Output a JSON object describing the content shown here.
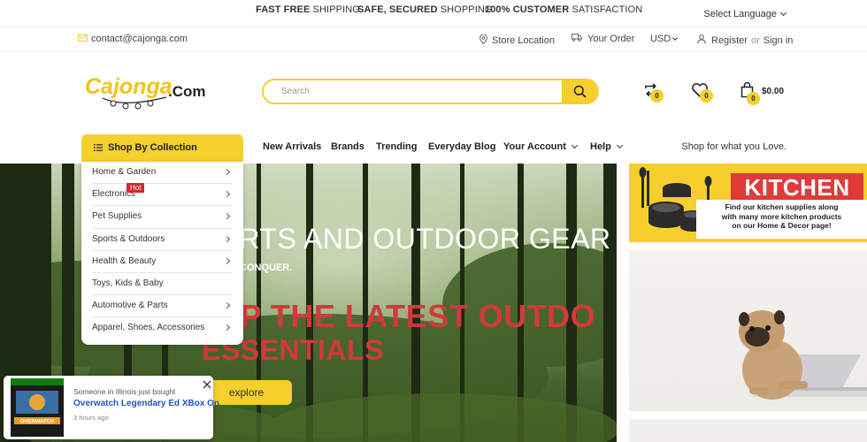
{
  "promo": {
    "item1_bold": "FAST FREE",
    "item1_rest": " SHIPPING",
    "item2_bold": "SAFE, SECURED",
    "item2_rest": " SHOPPING",
    "item3_bold": "100% CUSTOMER",
    "item3_rest": " SATISFACTION",
    "language": "Select Language"
  },
  "contactbar": {
    "email": "contact@cajonga.com",
    "store_location": "Store Location",
    "your_order": "Your Order",
    "currency": "USD",
    "register": "Register",
    "or": "or",
    "sign_in": "Sign in"
  },
  "header": {
    "logo_text": "CaJonga.Com",
    "search_placeholder": "Search",
    "compare_count": "0",
    "wishlist_count": "0",
    "cart_count": "0",
    "cart_total": "$0.00"
  },
  "nav": {
    "collection_label": "Shop By Collection",
    "items": [
      "New Arrivals",
      "Brands",
      "Trending",
      "Everyday Blog",
      "Your Account",
      "Help"
    ],
    "tagline": "Shop for what you Love."
  },
  "collections": [
    "Home & Garden",
    "Electronics",
    "Pet Supplies",
    "Sports & Outdoors",
    "Health & Beauty",
    "Toys, Kids & Baby",
    "Automotive & Parts",
    "Apparel, Shoes, Accessories"
  ],
  "hot_badge": "Hot",
  "hero": {
    "title": "ORTS AND OUTDOOR GEAR",
    "subtitle": "& CONQUER.",
    "headline_line1": "OP THE LATEST OUTDO",
    "headline_line2": "ESSENTIALS",
    "button": "explore"
  },
  "kitchen": {
    "title": "KITCHEN",
    "text_line1": "Find our kitchen supplies along",
    "text_line2": "with many more kitchen products",
    "text_line3": "on our Home & Decor page!"
  },
  "toast": {
    "line1": "Someone in Illinois just bought",
    "product": "Overwatch Legendary Ed XBox On",
    "time": "3 hours ago",
    "image_text": "OVERWATCH"
  },
  "colors": {
    "accent": "#f5cf2c",
    "red": "#d03a3a",
    "link_blue": "#2255c4"
  }
}
